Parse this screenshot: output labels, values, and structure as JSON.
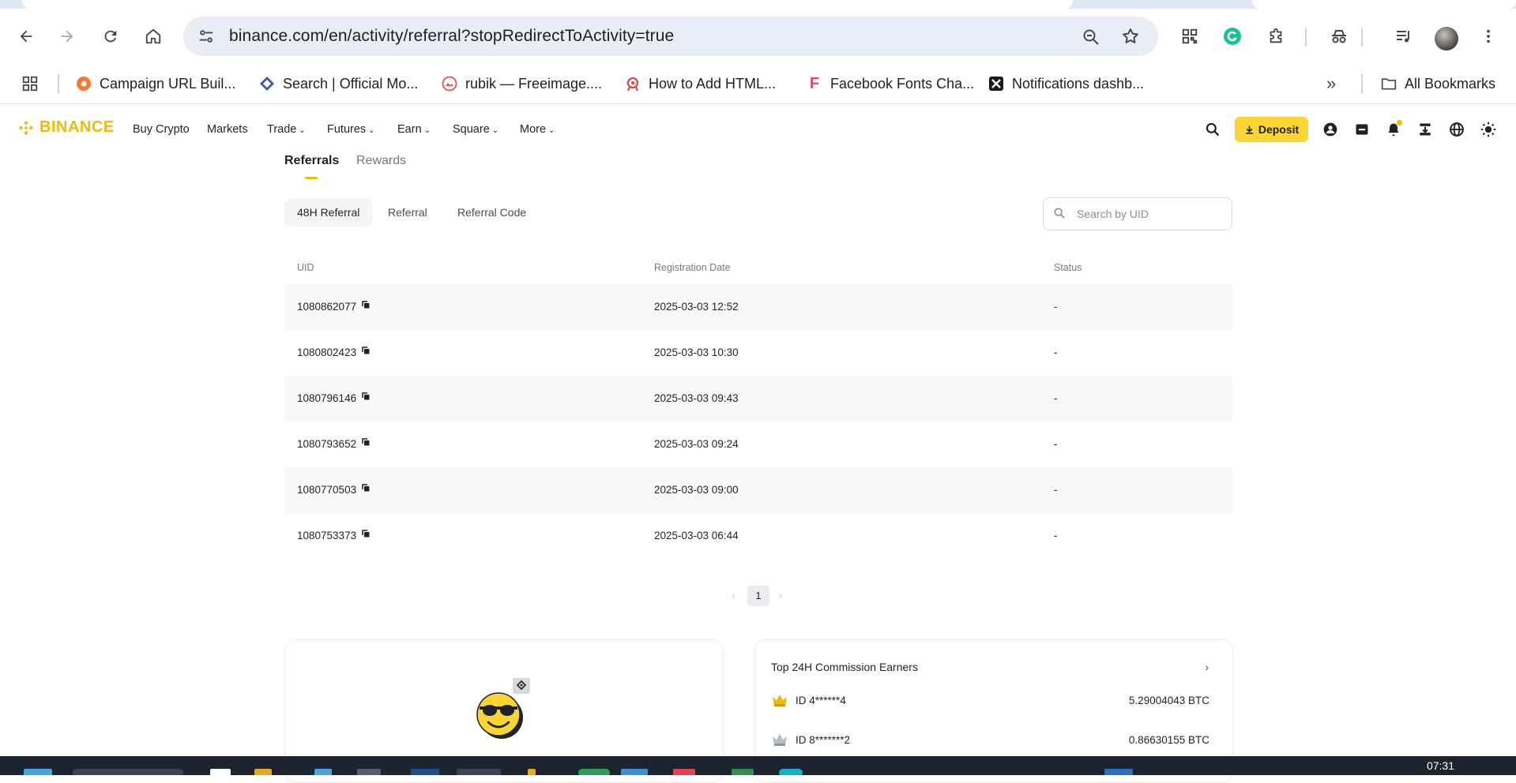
{
  "browser": {
    "url": "binance.com/en/activity/referral?stopRedirectToActivity=true",
    "bookmarks": [
      {
        "label": "Campaign URL Buil...",
        "icon": "campaign-favicon"
      },
      {
        "label": "Search | Official Mo...",
        "icon": "search-favicon"
      },
      {
        "label": "rubik — Freeimage....",
        "icon": "freeimage-favicon"
      },
      {
        "label": "How to Add HTML...",
        "icon": "html-favicon"
      },
      {
        "label": "Facebook Fonts Cha...",
        "icon": "facebook-fonts-favicon"
      },
      {
        "label": "Notifications dashb...",
        "icon": "notifications-favicon"
      }
    ],
    "all_bookmarks": "All Bookmarks"
  },
  "nav": {
    "logo": "BINANCE",
    "items": [
      "Buy Crypto",
      "Markets",
      "Trade",
      "Futures",
      "Earn",
      "Square",
      "More"
    ],
    "deposit": "Deposit",
    "brand_color": "#f0b90b",
    "deposit_color": "#fcd535"
  },
  "page": {
    "tabs": [
      "Referrals",
      "Rewards"
    ],
    "subtabs": [
      "48H Referral",
      "Referral",
      "Referral Code"
    ],
    "search_placeholder": "Search by UID",
    "columns": [
      "UID",
      "Registration Date",
      "Status"
    ],
    "rows": [
      {
        "uid": "1080862077",
        "date": "2025-03-03 12:52",
        "status": "-"
      },
      {
        "uid": "1080802423",
        "date": "2025-03-03 10:30",
        "status": "-"
      },
      {
        "uid": "1080796146",
        "date": "2025-03-03 09:43",
        "status": "-"
      },
      {
        "uid": "1080793652",
        "date": "2025-03-03 09:24",
        "status": "-"
      },
      {
        "uid": "1080770503",
        "date": "2025-03-03 09:00",
        "status": "-"
      },
      {
        "uid": "1080753373",
        "date": "2025-03-03 06:44",
        "status": "-"
      }
    ],
    "pagination": {
      "prev": "‹",
      "current": "1",
      "next": "›"
    }
  },
  "earners": {
    "title": "Top 24H Commission Earners",
    "items": [
      {
        "rank_icon": "crown-gold-icon",
        "id": "ID 4******4",
        "amount": "5.29004043 BTC"
      },
      {
        "rank_icon": "crown-silver-icon",
        "id": "ID 8*******2",
        "amount": "0.86630155 BTC"
      }
    ]
  },
  "taskbar": {
    "clock": "07:31"
  }
}
